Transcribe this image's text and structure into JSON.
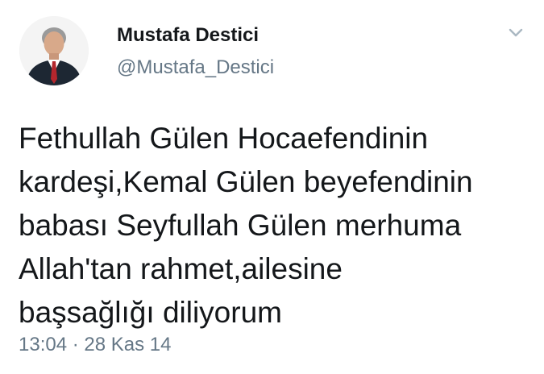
{
  "user": {
    "display_name": "Mustafa Destici",
    "handle": "@Mustafa_Destici",
    "avatar_icon": "profile-photo"
  },
  "tweet": {
    "text": "Fethullah Gülen Hocaefendinin\nkardeşi,Kemal Gülen beyefendinin\nbabası Seyfullah Gülen merhuma\nAllah'tan rahmet,ailesine\nbaşsağlığı diliyorum",
    "timestamp": "13:04 · 28 Kas 14"
  },
  "icons": {
    "menu": "chevron-down-icon"
  },
  "colors": {
    "primary_text": "#14171a",
    "secondary_text": "#657786",
    "chevron": "#aab8c2",
    "background": "#ffffff"
  }
}
